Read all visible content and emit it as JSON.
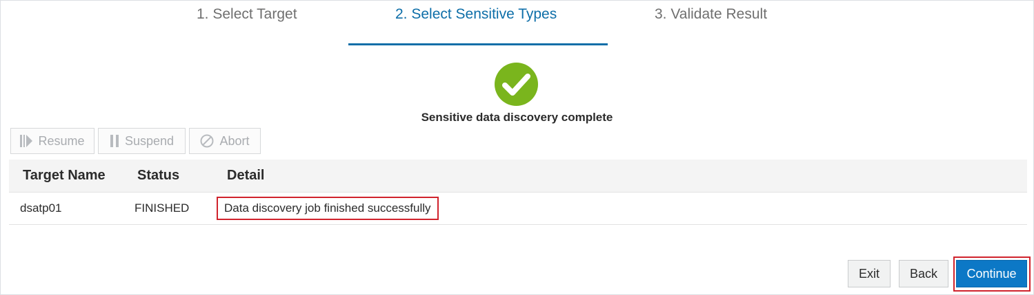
{
  "steps": [
    {
      "label": "1. Select Target",
      "active": false
    },
    {
      "label": "2. Select Sensitive Types",
      "active": true
    },
    {
      "label": "3. Validate Result",
      "active": false
    }
  ],
  "status": {
    "icon": "checkmark-circle-icon",
    "message": "Sensitive data discovery complete"
  },
  "toolbar": {
    "resume_label": "Resume",
    "suspend_label": "Suspend",
    "abort_label": "Abort"
  },
  "table": {
    "columns": [
      "Target Name",
      "Status",
      "Detail"
    ],
    "rows": [
      {
        "target_name": "dsatp01",
        "status": "FINISHED",
        "detail": "Data discovery job finished successfully"
      }
    ]
  },
  "footer": {
    "exit_label": "Exit",
    "back_label": "Back",
    "continue_label": "Continue"
  },
  "colors": {
    "accent": "#0d6ea8",
    "success": "#7ab51d",
    "primary_button": "#0c78c6",
    "highlight": "#d0222c"
  }
}
